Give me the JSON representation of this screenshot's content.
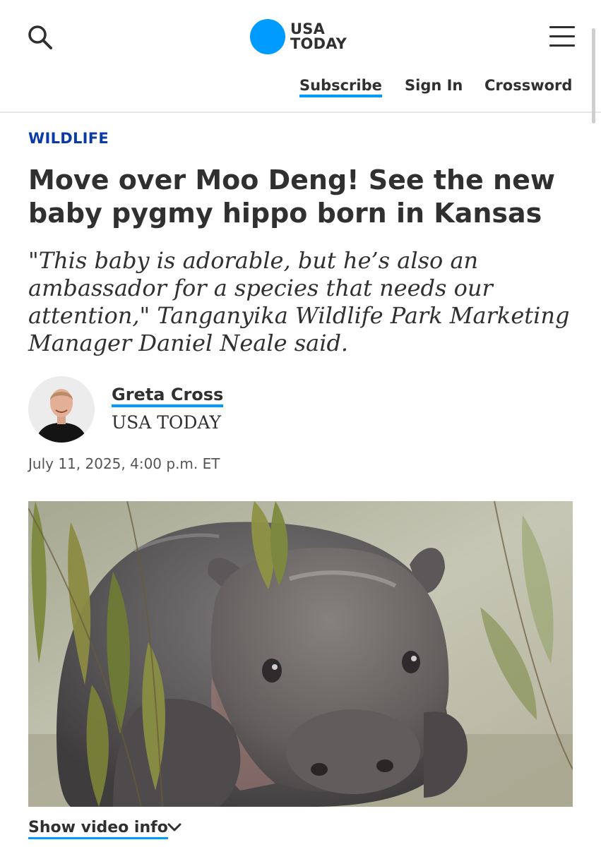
{
  "header": {
    "logo_line1": "USA",
    "logo_line2": "TODAY",
    "logo_color": "#009bff",
    "nav": {
      "subscribe": "Subscribe",
      "sign_in": "Sign In",
      "crossword": "Crossword"
    },
    "icons": {
      "search": "search-icon",
      "menu": "hamburger-menu-icon"
    }
  },
  "article": {
    "section": "WILDLIFE",
    "section_color": "#0a3aa6",
    "headline": "Move over Moo Deng! See the new baby pygmy hippo born in Kansas",
    "dek": "\"This baby is adorable, but he’s also an ambassador for a species that needs our attention,\" Tanganyika Wildlife Park Marketing Manager Daniel Neale said.",
    "author": {
      "name": "Greta Cross",
      "org": "USA TODAY"
    },
    "date": "July 11, 2025, 4:00 p.m. ET",
    "media": {
      "show_video_info": "Show video info"
    }
  }
}
